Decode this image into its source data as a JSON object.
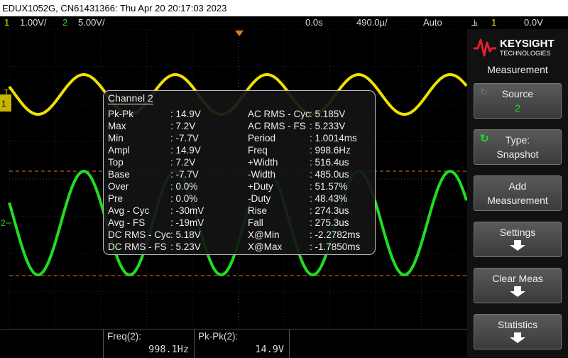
{
  "title": "EDUX1052G, CN61431366: Thu Apr 20 20:17:03 2023",
  "status": {
    "ch1_num": "1",
    "ch1_scale": "1.00V/",
    "ch2_num": "2",
    "ch2_scale": "5.00V/",
    "delay": "0.0s",
    "timebase": "490.0µ/",
    "mode": "Auto",
    "trig_src": "1",
    "trig_level": "0.0V"
  },
  "channel_markers": {
    "ch1": "1",
    "ch2": "2",
    "trigger": "T"
  },
  "popup": {
    "title": "Channel 2",
    "left": [
      {
        "label": "Pk-Pk",
        "value": ": 14.9V"
      },
      {
        "label": "Max",
        "value": ": 7.2V"
      },
      {
        "label": "Min",
        "value": ": -7.7V"
      },
      {
        "label": "Ampl",
        "value": ": 14.9V"
      },
      {
        "label": "Top",
        "value": ": 7.2V"
      },
      {
        "label": "Base",
        "value": ": -7.7V"
      },
      {
        "label": "Over",
        "value": ": 0.0%"
      },
      {
        "label": "Pre",
        "value": ": 0.0%"
      },
      {
        "label": "Avg - Cyc",
        "value": ": -30mV"
      },
      {
        "label": "Avg - FS",
        "value": ": -19mV"
      },
      {
        "label": "DC RMS - Cyc",
        "value": ": 5.18V"
      },
      {
        "label": "DC RMS - FS",
        "value": ": 5.23V"
      }
    ],
    "right": [
      {
        "label": "AC RMS - Cyc",
        "value": ": 5.185V"
      },
      {
        "label": "AC RMS - FS",
        "value": ": 5.233V"
      },
      {
        "label": "Period",
        "value": ": 1.0014ms"
      },
      {
        "label": "Freq",
        "value": ": 998.6Hz"
      },
      {
        "label": "+Width",
        "value": ": 516.4us"
      },
      {
        "label": "-Width",
        "value": ": 485.0us"
      },
      {
        "label": "+Duty",
        "value": ": 51.57%"
      },
      {
        "label": "-Duty",
        "value": ": 48.43%"
      },
      {
        "label": "Rise",
        "value": ": 274.3us"
      },
      {
        "label": "Fall",
        "value": ": 275.3us"
      },
      {
        "label": "X@Min",
        "value": ": -2.2782ms"
      },
      {
        "label": "X@Max",
        "value": ": -1.7850ms"
      }
    ]
  },
  "bottom": {
    "m1_label": "Freq(2):",
    "m1_value": "998.1Hz",
    "m2_label": "Pk-Pk(2):",
    "m2_value": "14.9V"
  },
  "panel": {
    "brand": "KEYSIGHT",
    "brand_sub": "TECHNOLOGIES",
    "title": "Measurement",
    "source_label": "Source",
    "source_value": "2",
    "type_label": "Type:",
    "type_value": "Snapshot",
    "add_l1": "Add",
    "add_l2": "Measurement",
    "settings": "Settings",
    "clear": "Clear Meas",
    "statistics": "Statistics"
  },
  "colors": {
    "ch1": "#f0e000",
    "ch2": "#22dd22",
    "ref_line": "#e07a1a",
    "accent": "#e0202a"
  }
}
